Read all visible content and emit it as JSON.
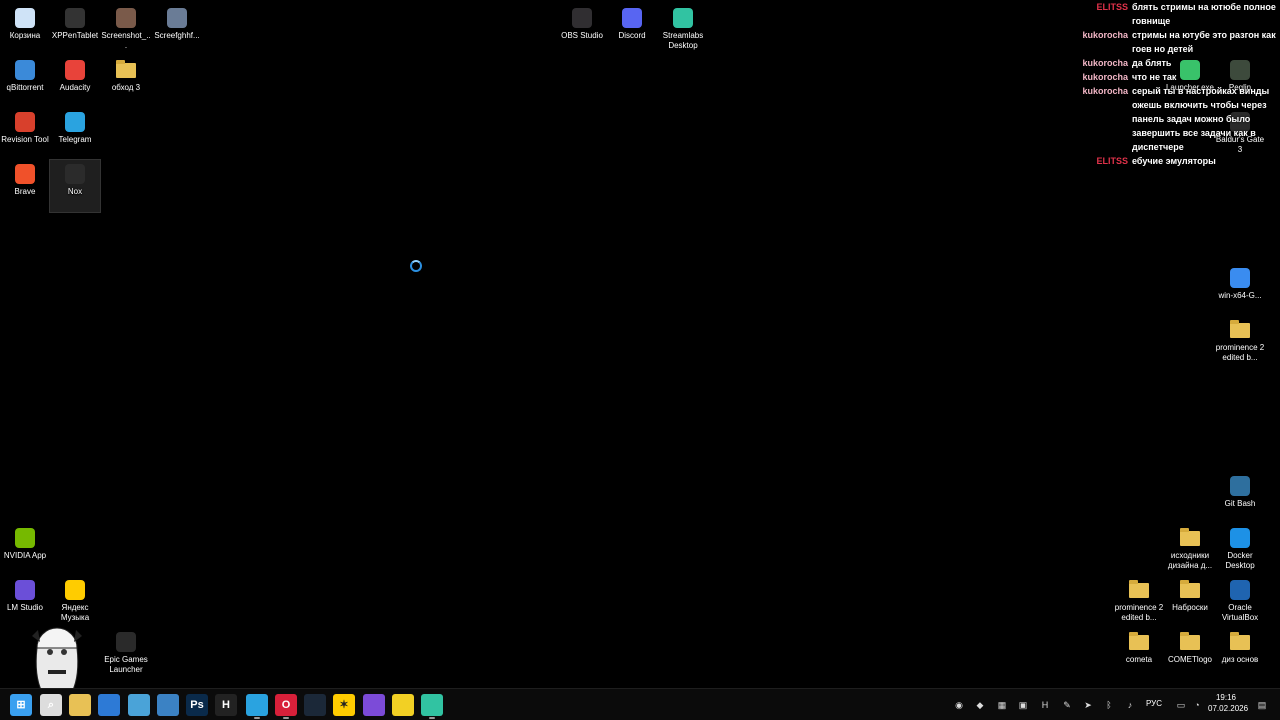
{
  "desktop": {
    "left_icons": [
      {
        "label": "Корзина",
        "icon": "recycle-bin-icon",
        "color": "#cfe3f7"
      },
      {
        "label": "XPPenTablet",
        "icon": "xp-pen-icon",
        "color": "#333333"
      },
      {
        "label": "Screenshot_...",
        "icon": "image-file-icon",
        "color": "#7a5a4a"
      },
      {
        "label": "Screefghhf...",
        "icon": "image-file-icon",
        "color": "#6a7c96"
      },
      {
        "label": "qBittorrent",
        "icon": "qbittorrent-icon",
        "color": "#3b8ad9"
      },
      {
        "label": "Audacity",
        "icon": "audacity-icon",
        "color": "#e8433a"
      },
      {
        "label": "обход 3",
        "icon": "folder-icon",
        "color": "#e8c155"
      },
      {
        "label": "Revision Tool",
        "icon": "revision-tool-icon",
        "color": "#d8402c"
      },
      {
        "label": "Telegram",
        "icon": "telegram-icon",
        "color": "#2aa3e0"
      },
      {
        "label": "Brave",
        "icon": "brave-icon",
        "color": "#f0512a"
      },
      {
        "label": "Nox",
        "icon": "nox-icon",
        "color": "#2b2b2b"
      },
      {
        "label": "NVIDIA App",
        "icon": "nvidia-icon",
        "color": "#76b900"
      },
      {
        "label": "LM Studio",
        "icon": "lm-studio-icon",
        "color": "#6b4fd8"
      },
      {
        "label": "Яндекс Музыка",
        "icon": "yandex-music-icon",
        "color": "#ffcc00"
      },
      {
        "label": "Epic Games Launcher",
        "icon": "epic-games-icon",
        "color": "#2a2a2a"
      }
    ],
    "top_icons": [
      {
        "label": "OBS Studio",
        "icon": "obs-icon",
        "color": "#302e31"
      },
      {
        "label": "Discord",
        "icon": "discord-icon",
        "color": "#5865f2"
      },
      {
        "label": "Streamlabs Desktop",
        "icon": "streamlabs-icon",
        "color": "#31c3a2"
      }
    ],
    "right_icons": [
      {
        "label": "Launcher.exe",
        "icon": "launcher-icon",
        "color": "#39c26a"
      },
      {
        "label": "Peglin",
        "icon": "peglin-icon",
        "color": "#3d4a3c"
      },
      {
        "label": "Baldur's Gate 3",
        "icon": "baldurs-gate-icon",
        "color": "#2a2a2a"
      },
      {
        "label": "win-x64-G...",
        "icon": "app-icon",
        "color": "#3a8cf0"
      },
      {
        "label": "prominence 2 edited b...",
        "icon": "folder-icon",
        "color": "#e8c155"
      },
      {
        "label": "Git Bash",
        "icon": "git-bash-icon",
        "color": "#2e6f9e"
      },
      {
        "label": "исходники дизайна д...",
        "icon": "folder-icon",
        "color": "#e8c155"
      },
      {
        "label": "Docker Desktop",
        "icon": "docker-icon",
        "color": "#1d91e6"
      },
      {
        "label": "prominence 2 edited b...",
        "icon": "folder-icon",
        "color": "#e8c155"
      },
      {
        "label": "Наброски",
        "icon": "folder-icon",
        "color": "#e8c155"
      },
      {
        "label": "Oracle VirtualBox",
        "icon": "virtualbox-icon",
        "color": "#1f64b0"
      },
      {
        "label": "cometa",
        "icon": "folder-icon",
        "color": "#e8c155"
      },
      {
        "label": "COMETlogo",
        "icon": "folder-icon",
        "color": "#e8c155"
      },
      {
        "label": "диз основ",
        "icon": "folder-icon",
        "color": "#e8c155"
      }
    ]
  },
  "chat": [
    {
      "user": "ELITSS",
      "user_color": "#e0324a",
      "msg": "блять стримы на ютюбе полное говнище"
    },
    {
      "user": "kukorocha",
      "user_color": "#f2b6c6",
      "msg": "стримы на ютубе это разгон как гоев но детей"
    },
    {
      "user": "kukorocha",
      "user_color": "#f2b6c6",
      "msg": "да блять"
    },
    {
      "user": "kukorocha",
      "user_color": "#f2b6c6",
      "msg": "что не так"
    },
    {
      "user": "kukorocha",
      "user_color": "#f2b6c6",
      "msg": "серый ты в настройках винды ожешь включить чтобы через панель задач можно было завершить все задачи как в диспетчере"
    },
    {
      "user": "ELITSS",
      "user_color": "#e0324a",
      "msg": "ебучие эмуляторы"
    }
  ],
  "taskbar": {
    "apps": [
      {
        "name": "start-button",
        "icon": "windows-icon",
        "glyph": "⊞",
        "color": "#3aa0f0",
        "running": false
      },
      {
        "name": "search-button",
        "icon": "search-icon",
        "glyph": "⌕",
        "color": "#dddddd",
        "running": false
      },
      {
        "name": "file-explorer-button",
        "icon": "folder-icon",
        "glyph": "",
        "color": "#e8c155",
        "running": false
      },
      {
        "name": "store-button",
        "icon": "store-icon",
        "glyph": "",
        "color": "#2d7ad6",
        "running": false
      },
      {
        "name": "app-button-1",
        "icon": "window-icon",
        "glyph": "",
        "color": "#4aa3d8",
        "running": false
      },
      {
        "name": "app-button-2",
        "icon": "photos-icon",
        "glyph": "",
        "color": "#3b82c4",
        "running": false
      },
      {
        "name": "photoshop-button",
        "icon": "photoshop-icon",
        "glyph": "Ps",
        "color": "#0a2a4a",
        "running": false
      },
      {
        "name": "app-button-h",
        "icon": "h-icon",
        "glyph": "H",
        "color": "#222222",
        "running": false
      },
      {
        "name": "telegram-button",
        "icon": "telegram-icon",
        "glyph": "",
        "color": "#2aa3e0",
        "running": true
      },
      {
        "name": "opera-button",
        "icon": "opera-icon",
        "glyph": "O",
        "color": "#d8203a",
        "running": true
      },
      {
        "name": "steam-button",
        "icon": "steam-icon",
        "glyph": "",
        "color": "#1b2838",
        "running": false
      },
      {
        "name": "yandex-music-button",
        "icon": "yandex-music-icon",
        "glyph": "✶",
        "color": "#ffcc00",
        "running": false
      },
      {
        "name": "visual-studio-button",
        "icon": "visual-studio-icon",
        "glyph": "",
        "color": "#7c4bd8",
        "running": false
      },
      {
        "name": "app-button-lock",
        "icon": "lock-icon",
        "glyph": "",
        "color": "#f2d024",
        "running": false
      },
      {
        "name": "streamlabs-button",
        "icon": "streamlabs-icon",
        "glyph": "",
        "color": "#31c3a2",
        "running": true
      }
    ],
    "tray_icons": [
      "tray-app-icon",
      "nvidia-icon",
      "tray-app-icon",
      "tray-app-icon",
      "h-icon",
      "pen-icon",
      "telegram-icon",
      "bluetooth-icon",
      "microphone-icon"
    ],
    "language": "РУС",
    "time": "19:16",
    "date": "07.02.2026"
  }
}
